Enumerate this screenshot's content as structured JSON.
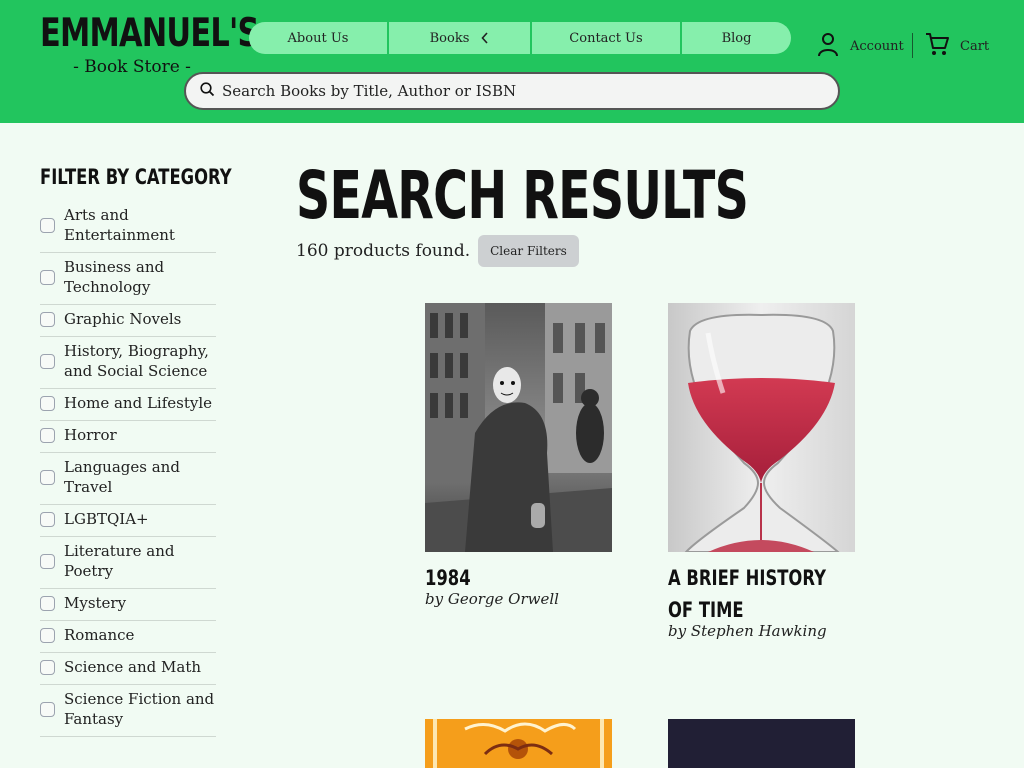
{
  "header": {
    "logo_name": "EMMANUEL'S",
    "logo_sub": "- Book Store -",
    "nav": [
      "About Us",
      "Books",
      "Contact Us",
      "Blog"
    ],
    "account_label": "Account",
    "cart_label": "Cart",
    "search_placeholder": "Search Books by Title, Author or ISBN"
  },
  "sidebar": {
    "title": "FILTER BY CATEGORY",
    "categories": [
      "Arts and Entertainment",
      "Business and Technology",
      "Graphic Novels",
      "History, Biography, and Social Science",
      "Home and Lifestyle",
      "Horror",
      "Languages and Travel",
      "LGBTQIA+",
      "Literature and Poetry",
      "Mystery",
      "Romance",
      "Science and Math",
      "Science Fiction and Fantasy"
    ]
  },
  "main": {
    "title": "SEARCH RESULTS",
    "count": "160 products found.",
    "clear_label": "Clear Filters",
    "books": [
      {
        "title": "1984",
        "author": "by George Orwell"
      },
      {
        "title": "A BRIEF HISTORY\nOF TIME",
        "author": "by Stephen Hawking"
      }
    ]
  },
  "colors": {
    "header_green": "#22c55e",
    "nav_green": "#86efac",
    "page_bg": "#f1fbf3"
  }
}
